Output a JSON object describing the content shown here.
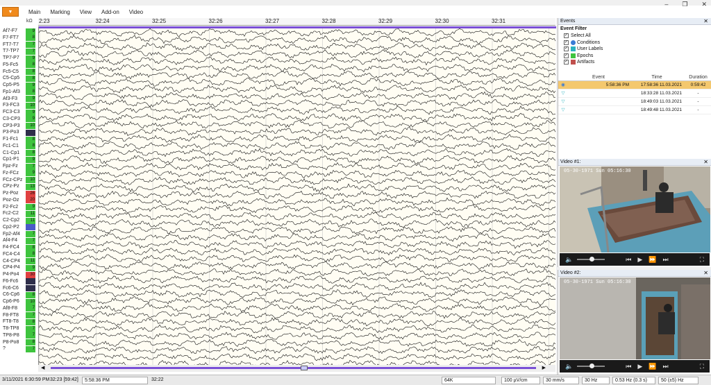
{
  "menu": {
    "items": [
      "Main",
      "Marking",
      "View",
      "Add-on",
      "Video"
    ],
    "window_controls": [
      "–",
      "❐",
      "✕"
    ]
  },
  "eeg": {
    "impedance_unit": "kΩ",
    "time_ticks": [
      "2:23",
      "32:24",
      "32:25",
      "32:26",
      "32:27",
      "32:28",
      "32:29",
      "32:30",
      "32:31"
    ],
    "channels": [
      {
        "name": "Af7-F7",
        "imp": "9",
        "color": "#3ec43e"
      },
      {
        "name": "F7-FT7",
        "imp": "8",
        "color": "#3ec43e"
      },
      {
        "name": "FT7-T7",
        "imp": "7",
        "color": "#3ec43e"
      },
      {
        "name": "T7-TP7",
        "imp": "7",
        "color": "#3ec43e"
      },
      {
        "name": "TP7-P7",
        "imp": "9",
        "color": "#3ec43e"
      },
      {
        "name": "F5-Fc5",
        "imp": "8",
        "color": "#3ec43e"
      },
      {
        "name": "Fc5-C5",
        "imp": "8",
        "color": "#3ec43e"
      },
      {
        "name": "C5-Cp5",
        "imp": "8",
        "color": "#3ec43e"
      },
      {
        "name": "Cp5-P5",
        "imp": "9",
        "color": "#3ec43e"
      },
      {
        "name": "Fp1-Af3",
        "imp": "8",
        "color": "#3ec43e"
      },
      {
        "name": "Af3-F3",
        "imp": "9",
        "color": "#3ec43e"
      },
      {
        "name": "F3-FC3",
        "imp": "10",
        "color": "#3ec43e"
      },
      {
        "name": "FC3-C3",
        "imp": "9",
        "color": "#3ec43e"
      },
      {
        "name": "C3-CP3",
        "imp": "9",
        "color": "#3ec43e"
      },
      {
        "name": "CP3-P3",
        "imp": "10",
        "color": "#3ec43e"
      },
      {
        "name": "P3-Po3",
        "imp": "",
        "color": "#2e2e4a"
      },
      {
        "name": "F1-Fc1",
        "imp": "8",
        "color": "#3ec43e"
      },
      {
        "name": "Fc1-C1",
        "imp": "8",
        "color": "#3ec43e"
      },
      {
        "name": "C1-Cp1",
        "imp": "8",
        "color": "#3ec43e"
      },
      {
        "name": "Cp1-P1",
        "imp": "9",
        "color": "#3ec43e"
      },
      {
        "name": "Fpz-Fz",
        "imp": "7",
        "color": "#3ec43e"
      },
      {
        "name": "Fz-FCz",
        "imp": "9",
        "color": "#3ec43e"
      },
      {
        "name": "FCz-CPz",
        "imp": "10",
        "color": "#3ec43e"
      },
      {
        "name": "CPz-Pz",
        "imp": "13",
        "color": "#3ec43e"
      },
      {
        "name": "Pz-Poz",
        "imp": "26",
        "color": "#e04040"
      },
      {
        "name": "Poz-Oz",
        "imp": "20",
        "color": "#e04040"
      },
      {
        "name": "F2-Fc2",
        "imp": "9",
        "color": "#3ec43e"
      },
      {
        "name": "Fc2-C2",
        "imp": "11",
        "color": "#3ec43e"
      },
      {
        "name": "C2-Cp2",
        "imp": "11",
        "color": "#3ec43e"
      },
      {
        "name": "Cp2-P2",
        "imp": "",
        "color": "#4a5ac8"
      },
      {
        "name": "Fp2-Af4",
        "imp": "7",
        "color": "#3ec43e"
      },
      {
        "name": "Af4-F4",
        "imp": "7",
        "color": "#3ec43e"
      },
      {
        "name": "F4-FC4",
        "imp": "8",
        "color": "#3ec43e"
      },
      {
        "name": "FC4-C4",
        "imp": "8",
        "color": "#3ec43e"
      },
      {
        "name": "C4-CP4",
        "imp": "11",
        "color": "#3ec43e"
      },
      {
        "name": "CP4-P4",
        "imp": "9",
        "color": "#3ec43e"
      },
      {
        "name": "P4-Po4",
        "imp": "30",
        "color": "#e04040"
      },
      {
        "name": "F6-Fc6",
        "imp": "",
        "color": "#2e2e4a"
      },
      {
        "name": "Fc6-C6",
        "imp": "",
        "color": "#2e2e4a"
      },
      {
        "name": "C6-Cp6",
        "imp": "8",
        "color": "#3ec43e"
      },
      {
        "name": "Cp6-P6",
        "imp": "10",
        "color": "#3ec43e"
      },
      {
        "name": "Af8-F8",
        "imp": "7",
        "color": "#3ec43e"
      },
      {
        "name": "F8-FT8",
        "imp": "7",
        "color": "#3ec43e"
      },
      {
        "name": "FT8-T8",
        "imp": "8",
        "color": "#3ec43e"
      },
      {
        "name": "T8-TP8",
        "imp": "7",
        "color": "#3ec43e"
      },
      {
        "name": "TP8-P8",
        "imp": "7",
        "color": "#3ec43e"
      },
      {
        "name": "P8-Po8",
        "imp": "8",
        "color": "#3ec43e"
      },
      {
        "name": "?",
        "imp": "7",
        "color": "#3ec43e"
      }
    ]
  },
  "events_panel": {
    "title": "Events",
    "filter_title": "Event Filter",
    "filters": [
      {
        "label": "Select All",
        "icon": "none"
      },
      {
        "label": "Conditions",
        "icon": "condition-icon"
      },
      {
        "label": "User Labels",
        "icon": "label-icon"
      },
      {
        "label": "Epochs",
        "icon": "epoch-icon"
      },
      {
        "label": "Artifacts",
        "icon": "artifact-icon"
      }
    ],
    "columns": {
      "event": "Event",
      "time": "Time",
      "duration": "Duration"
    },
    "rows": [
      {
        "event": "5:58:36 PM",
        "time": "17:58:36 11.03.2021",
        "duration": "0:59:42",
        "selected": true
      },
      {
        "event": "",
        "time": "18:33:28 11.03.2021",
        "duration": "-",
        "selected": false
      },
      {
        "event": "",
        "time": "18:49:03 11.03.2021",
        "duration": "-",
        "selected": false
      },
      {
        "event": "",
        "time": "18:49:48 11.03.2021",
        "duration": "-",
        "selected": false
      }
    ]
  },
  "video1": {
    "title": "Video #1:",
    "timestamp": "05-30-1971 Sun 05:16:30"
  },
  "video2": {
    "title": "Video #2:",
    "timestamp": "05-30-1971 Sun 05:16:30"
  },
  "status": {
    "datetime": "3/11/2021 6:30:59 PM",
    "position": "32:23  [59:42]",
    "event": "5:58:36 PM",
    "cursor_time": "32:22",
    "samples": "64K",
    "sensitivity": "100 µV/cm",
    "speed": "30 mm/s",
    "hf": "30 Hz",
    "lf": "0.53 Hz (0.3 s)",
    "notch": "50 (±5) Hz"
  }
}
